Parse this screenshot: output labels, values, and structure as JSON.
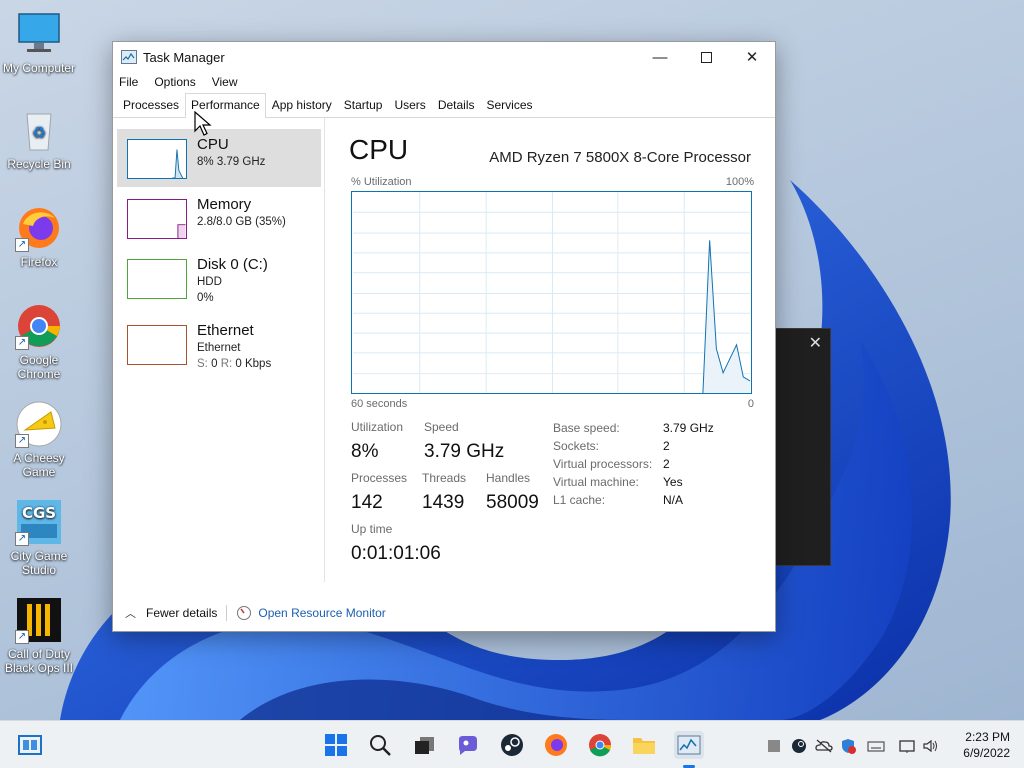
{
  "desktop": {
    "icons": [
      {
        "label": "My Computer",
        "icon": "monitor-icon"
      },
      {
        "label": "Recycle Bin",
        "icon": "recycle-bin-icon"
      },
      {
        "label": "Firefox",
        "icon": "firefox-icon"
      },
      {
        "label": "Google Chrome",
        "icon": "chrome-icon"
      },
      {
        "label": "A Cheesy Game",
        "icon": "cheese-icon"
      },
      {
        "label": "City Game Studio",
        "icon": "cgs-icon"
      },
      {
        "label": "Call of Duty Black Ops III",
        "icon": "cod-icon"
      }
    ],
    "cgs_logo_text": "CGS"
  },
  "task_manager": {
    "title": "Task Manager",
    "menu": [
      "File",
      "Options",
      "View"
    ],
    "tabs": [
      "Processes",
      "Performance",
      "App history",
      "Startup",
      "Users",
      "Details",
      "Services"
    ],
    "active_tab": "Performance",
    "sidebar": [
      {
        "name": "CPU",
        "sub1": "8%  3.79 GHz",
        "sub2": "",
        "color": "#1172b0"
      },
      {
        "name": "Memory",
        "sub1": "2.8/8.0 GB (35%)",
        "sub2": "",
        "color": "#8b1a89"
      },
      {
        "name": "Disk 0 (C:)",
        "sub1": "HDD",
        "sub2": "0%",
        "color": "#4da63a"
      },
      {
        "name": "Ethernet",
        "sub1": "Ethernet",
        "sub2_label_s": "S:",
        "sub2_val_s": "0",
        "sub2_label_r": "R:",
        "sub2_val_r": "0 Kbps",
        "color": "#a7542a"
      }
    ],
    "main": {
      "title": "CPU",
      "model": "AMD Ryzen 7 5800X 8-Core Processor",
      "graph_label": "% Utilization",
      "graph_max": "100%",
      "graph_time": "60 seconds",
      "graph_min": "0",
      "stats": {
        "utilization_label": "Utilization",
        "utilization": "8%",
        "speed_label": "Speed",
        "speed": "3.79 GHz",
        "processes_label": "Processes",
        "processes": "142",
        "threads_label": "Threads",
        "threads": "1439",
        "handles_label": "Handles",
        "handles": "58009",
        "uptime_label": "Up time",
        "uptime": "0:01:01:06"
      },
      "details": [
        {
          "key": "Base speed:",
          "value": "3.79 GHz"
        },
        {
          "key": "Sockets:",
          "value": "2"
        },
        {
          "key": "Virtual processors:",
          "value": "2"
        },
        {
          "key": "Virtual machine:",
          "value": "Yes"
        },
        {
          "key": "L1 cache:",
          "value": "N/A"
        }
      ]
    },
    "footer": {
      "fewer": "Fewer details",
      "resource_monitor": "Open Resource Monitor"
    }
  },
  "cpu_series": [
    0,
    0,
    0,
    0,
    0,
    0,
    0,
    0,
    0,
    0,
    0,
    0,
    0,
    0,
    0,
    0,
    0,
    0,
    0,
    0,
    0,
    0,
    0,
    0,
    0,
    0,
    0,
    0,
    0,
    0,
    0,
    0,
    0,
    0,
    0,
    0,
    0,
    0,
    0,
    0,
    0,
    0,
    0,
    0,
    0,
    0,
    0,
    0,
    0,
    0,
    0,
    0,
    0,
    76,
    22,
    10,
    17,
    24,
    8,
    6
  ],
  "taskbar": {
    "icons": [
      "start-icon",
      "search-icon",
      "task-view-icon",
      "chat-icon",
      "steam-icon",
      "firefox-icon",
      "chrome-icon",
      "file-explorer-icon",
      "task-manager-icon"
    ],
    "tray": [
      "tray-app-icon",
      "steam-tray-icon",
      "onedrive-icon",
      "security-icon",
      "keyboard-icon",
      "network-icon",
      "volume-icon"
    ],
    "time": "2:23 PM",
    "date": "6/9/2022"
  }
}
